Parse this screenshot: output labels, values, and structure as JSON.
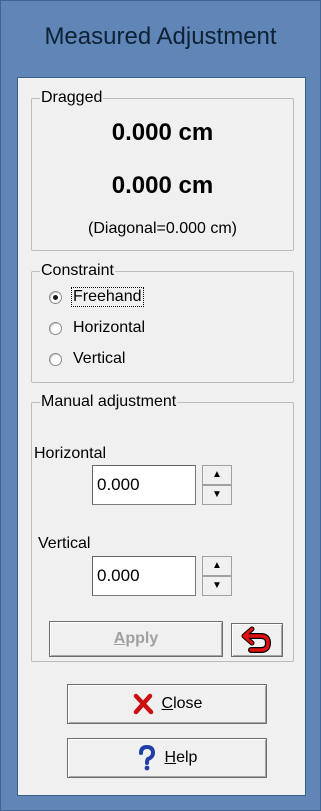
{
  "window": {
    "title": "Measured Adjustment"
  },
  "dragged": {
    "legend": "Dragged",
    "value_1": "0.000 cm",
    "value_2": "0.000 cm",
    "diagonal": "(Diagonal=0.000 cm)"
  },
  "constraint": {
    "legend": "Constraint",
    "options": [
      {
        "label": "Freehand",
        "selected": true
      },
      {
        "label": "Horizontal",
        "selected": false
      },
      {
        "label": "Vertical",
        "selected": false
      }
    ]
  },
  "manual": {
    "legend": "Manual adjustment",
    "horizontal_label": "Horizontal",
    "horizontal_value": "0.000",
    "vertical_label": "Vertical",
    "vertical_value": "0.000",
    "apply_label": "Apply",
    "apply_access_key": "A",
    "apply_rest": "pply"
  },
  "buttons": {
    "close_key": "C",
    "close_rest": "lose",
    "help_key": "H",
    "help_rest": "elp"
  },
  "icons": {
    "undo": "undo-arrow-icon",
    "close": "red-x-icon",
    "help": "question-mark-icon"
  },
  "colors": {
    "title_bar": "#5f86b6",
    "close_icon": "#cc1010",
    "help_icon": "#1f3ea8",
    "undo_icon": "#e01010"
  }
}
